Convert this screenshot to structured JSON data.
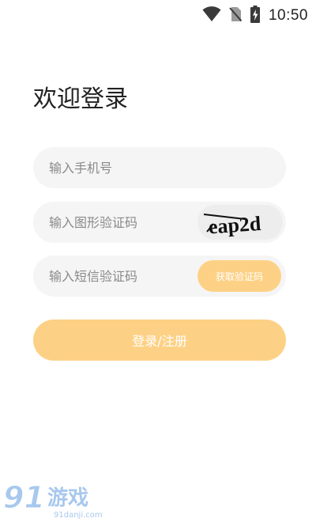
{
  "status_bar": {
    "time": "10:50",
    "icons": [
      "wifi-icon",
      "no-sim-icon",
      "battery-charging-icon"
    ]
  },
  "login": {
    "title": "欢迎登录",
    "phone_placeholder": "输入手机号",
    "captcha_placeholder": "输入图形验证码",
    "captcha_text": "eap2d",
    "sms_placeholder": "输入短信验证码",
    "sms_button_label": "获取验证码",
    "submit_label": "登录/注册"
  },
  "colors": {
    "accent": "#fdd185",
    "field_bg": "#f5f5f5",
    "title": "#222222",
    "placeholder": "#8a8a8a"
  },
  "watermark": {
    "logo": "91游戏",
    "url": "91danji.com"
  }
}
